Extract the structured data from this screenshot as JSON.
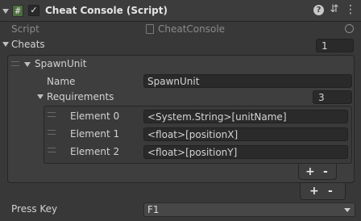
{
  "component": {
    "title": "Cheat Console (Script)",
    "enabled": true
  },
  "script_field": {
    "label": "Script",
    "value": "CheatConsole"
  },
  "cheats": {
    "label": "Cheats",
    "size": "1",
    "items": [
      {
        "label": "SpawnUnit",
        "name_label": "Name",
        "name_value": "SpawnUnit",
        "requirements_label": "Requirements",
        "requirements_size": "3",
        "elements": [
          {
            "label": "Element 0",
            "value": "<System.String>[unitName]"
          },
          {
            "label": "Element 1",
            "value": "<float>[positionX]"
          },
          {
            "label": "Element 2",
            "value": "<float>[positionY]"
          }
        ]
      }
    ],
    "add_label": "+",
    "remove_label": "-"
  },
  "press_key": {
    "label": "Press Key",
    "value": "F1"
  }
}
